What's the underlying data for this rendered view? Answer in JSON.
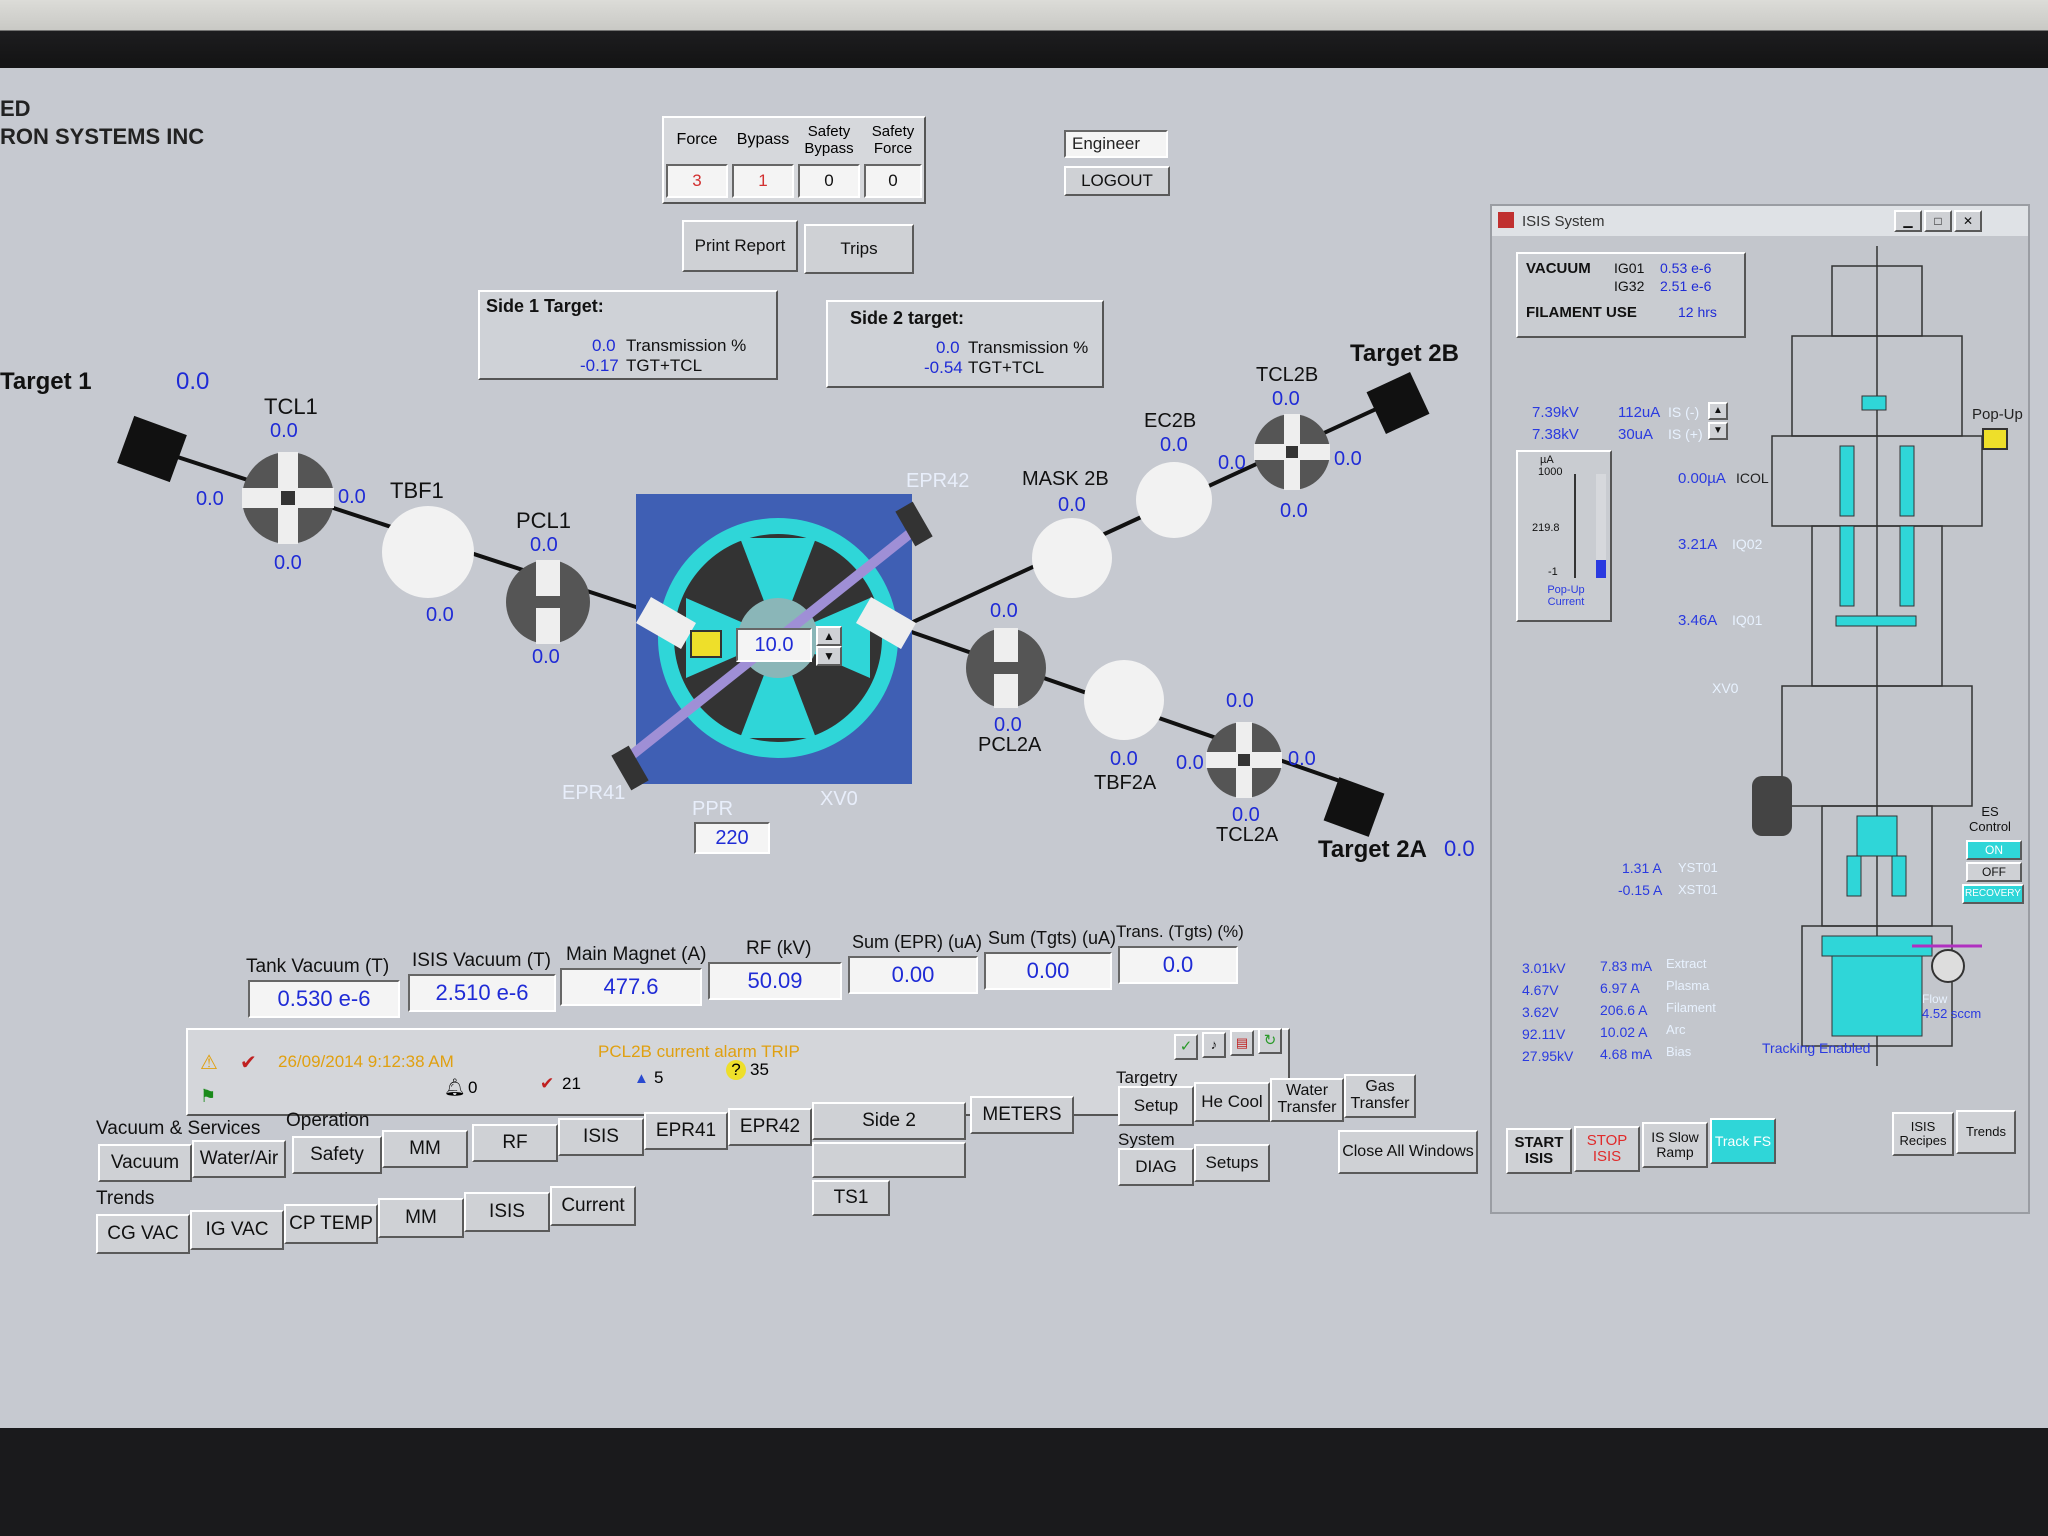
{
  "company": {
    "line1": "ED",
    "line2": "RON SYSTEMS INC"
  },
  "override_table": {
    "headers": [
      "Force",
      "Bypass",
      "Safety Bypass",
      "Safety Force"
    ],
    "values": [
      "3",
      "1",
      "0",
      "0"
    ]
  },
  "user": {
    "role": "Engineer",
    "logout": "LOGOUT"
  },
  "buttons": {
    "print_report": "Print Report",
    "trips": "Trips"
  },
  "side1": {
    "title": "Side 1 Target:",
    "transmission_value": "0.0",
    "transmission_label": "Transmission %",
    "tgt_value": "-0.17",
    "tgt_label": "TGT+TCL"
  },
  "side2": {
    "title": "Side 2 target:",
    "transmission_value": "0.0",
    "transmission_label": "Transmission %",
    "tgt_value": "-0.54",
    "tgt_label": "TGT+TCL"
  },
  "beamline": {
    "target1": {
      "label": "Target 1",
      "value": "0.0"
    },
    "target2b": {
      "label": "Target 2B"
    },
    "target2a": {
      "label": "Target 2A",
      "value": "0.0"
    },
    "tcl1": {
      "label": "TCL1",
      "top": "0.0",
      "left": "0.0",
      "right": "0.0",
      "bottom": "0.0"
    },
    "tbf1": {
      "label": "TBF1",
      "bottom": "0.0"
    },
    "pcl1": {
      "label": "PCL1",
      "top": "0.0",
      "bottom": "0.0"
    },
    "mask2b": {
      "label": "MASK 2B",
      "top": "0.0"
    },
    "ec2b": {
      "label": "EC2B",
      "top": "0.0"
    },
    "tcl2b": {
      "label": "TCL2B",
      "top": "0.0",
      "left": "0.0",
      "right": "0.0",
      "bottom": "0.0"
    },
    "pcl2a": {
      "label": "PCL2A",
      "top": "0.0",
      "bottom": "0.0"
    },
    "tbf2a": {
      "label": "TBF2A",
      "bottom": "0.0"
    },
    "tcl2a": {
      "label": "TCL2A",
      "top": "0.0",
      "left": "0.0",
      "right": "0.0",
      "bottom": "0.0"
    },
    "epr41": "EPR41",
    "epr42": "EPR42",
    "ppr": {
      "label": "PPR",
      "value": "220"
    },
    "xv0": "XV0",
    "stripper_setpoint": "10.0"
  },
  "meters": [
    {
      "label": "Tank Vacuum (T)",
      "value": "0.530 e-6"
    },
    {
      "label": "ISIS Vacuum (T)",
      "value": "2.510 e-6"
    },
    {
      "label": "Main Magnet (A)",
      "value": "477.6"
    },
    {
      "label": "RF (kV)",
      "value": "50.09"
    },
    {
      "label": "Sum (EPR) (uA)",
      "value": "0.00"
    },
    {
      "label": "Sum (Tgts) (uA)",
      "value": "0.00"
    },
    {
      "label": "Trans. (Tgts) (%)",
      "value": "0.0"
    }
  ],
  "alarm": {
    "timestamp": "26/09/2014 9:12:38 AM",
    "message": "PCL2B current alarm TRIP",
    "count_bell": "0",
    "count_check": "21",
    "count_flag": "5",
    "count_question": "35"
  },
  "nav": {
    "vacuum_services_label": "Vacuum & Services",
    "operation_label": "Operation",
    "vacuum": "Vacuum",
    "water_air": "Water/Air",
    "safety": "Safety",
    "mm": "MM",
    "rf": "RF",
    "isis": "ISIS",
    "epr41": "EPR41",
    "epr42": "EPR42",
    "side2": "Side 2",
    "meters": "METERS",
    "ts1": "TS1",
    "trends_label": "Trends",
    "cg_vac": "CG VAC",
    "ig_vac": "IG VAC",
    "cp_temp": "CP TEMP",
    "trend_mm": "MM",
    "trend_isis": "ISIS",
    "current": "Current",
    "targetry_label": "Targetry",
    "setup": "Setup",
    "he_cool": "He Cool",
    "water_transfer": "Water Transfer",
    "gas_transfer": "Gas Transfer",
    "system_label": "System",
    "diag": "DIAG",
    "setups": "Setups",
    "close_all": "Close All Windows"
  },
  "isis_window": {
    "title": "ISIS System",
    "vacuum_label": "VACUUM",
    "ig01_label": "IG01",
    "ig01_value": "0.53 e-6",
    "ig32_label": "IG32",
    "ig32_value": "2.51 e-6",
    "filament_label": "FILAMENT USE",
    "filament_value": "12 hrs",
    "is_minus_kv": "7.39kV",
    "is_minus_ua": "112uA",
    "is_minus_label": "IS (-)",
    "is_plus_kv": "7.38kV",
    "is_plus_ua": "30uA",
    "is_plus_label": "IS (+)",
    "gauge_unit": "µA",
    "gauge_top": "1000",
    "gauge_mid": "219.8",
    "gauge_bottom": "-1",
    "gauge_level": 0.03,
    "gauge_label": "Pop-Up Current",
    "icol_value": "0.00µA",
    "icol_label": "ICOL",
    "iq02_value": "3.21A",
    "iq02_label": "IQ02",
    "iq01_value": "3.46A",
    "iq01_label": "IQ01",
    "xv0": "XV0",
    "popup": "Pop-Up",
    "yst01_value": "1.31 A",
    "yst01_label": "YST01",
    "xst01_value": "-0.15 A",
    "xst01_label": "XST01",
    "es_control": "ES Control",
    "on": "ON",
    "off": "OFF",
    "recovery": "RECOVERY",
    "readouts": [
      {
        "kv": "3.01kV",
        "ma": "7.83 mA",
        "name": "Extract"
      },
      {
        "kv": "4.67V",
        "ma": "6.97 A",
        "name": "Plasma"
      },
      {
        "kv": "3.62V",
        "ma": "206.6 A",
        "name": "Filament"
      },
      {
        "kv": "92.11V",
        "ma": "10.02 A",
        "name": "Arc"
      },
      {
        "kv": "27.95kV",
        "ma": "4.68 mA",
        "name": "Bias"
      }
    ],
    "flow_label": "Flow",
    "flow_value": "4.52 sccm",
    "tracking": "Tracking Enabled",
    "start": "START ISIS",
    "stop": "STOP ISIS",
    "slow_ramp": "IS Slow Ramp",
    "track_fs": "Track FS",
    "recipes": "ISIS Recipes",
    "trends": "Trends"
  },
  "colors": {
    "screen_bg": "#c6c9d0",
    "value_blue": "#1f2bd6",
    "cyan": "#2fd6d8",
    "stop_red": "#e02a2a",
    "alarm_orange": "#e0a010"
  }
}
